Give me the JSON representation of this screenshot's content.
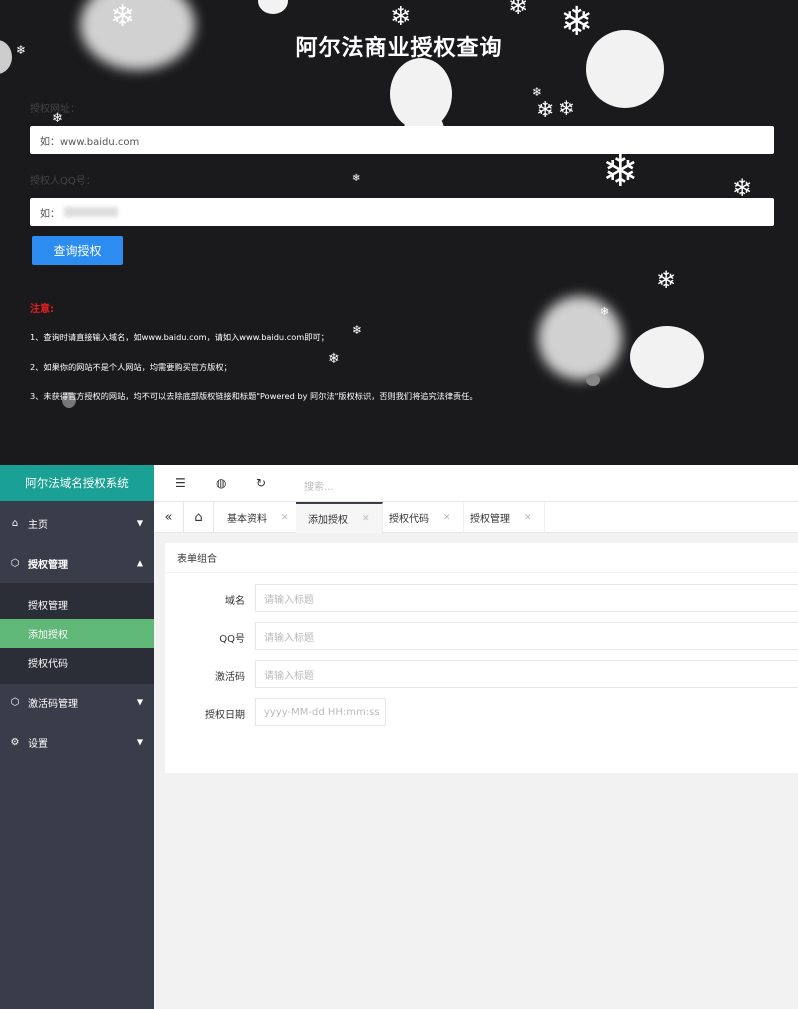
{
  "query": {
    "title": "阿尔法商业授权查询",
    "url_label": "授权网址：",
    "url_placeholder": "如：www.baidu.com",
    "qq_label": "授权人QQ号：",
    "qq_placeholder": "如：",
    "button": "查询授权",
    "notice_title": "注意:",
    "notices": [
      "1、查询时请直接输入域名，如www.baidu.com，请如入www.baidu.com即可；",
      "2、如果你的网站不是个人网站，均需要购买官方版权；",
      "3、未获得官方授权的网站，均不可以去除底部版权链接和标题\"Powered by 阿尔法\"版权标识，否则我们将追究法律责任。"
    ]
  },
  "admin": {
    "logo": "阿尔法域名授权系统",
    "nav": [
      {
        "label": "主页",
        "icon": "home-icon"
      },
      {
        "label": "授权管理",
        "icon": "cube-icon"
      },
      {
        "label": "激活码管理",
        "icon": "cube-icon"
      },
      {
        "label": "设置",
        "icon": "gear-icon"
      }
    ],
    "sub_items": [
      "授权管理",
      "添加授权",
      "授权代码"
    ],
    "search_placeholder": "搜索...",
    "tabs": [
      "基本资料",
      "添加授权",
      "授权代码",
      "授权管理"
    ],
    "card_title": "表单组合",
    "form": [
      {
        "label": "域名",
        "placeholder": "请输入标题"
      },
      {
        "label": "QQ号",
        "placeholder": "请输入标题"
      },
      {
        "label": "激活码",
        "placeholder": "请输入标题"
      },
      {
        "label": "授权日期",
        "placeholder": "yyyy-MM-dd HH:mm:ss"
      }
    ],
    "colors": {
      "logo_bg": "#1aa094",
      "active_bg": "#5fb878",
      "sidebar_bg": "#393d49",
      "button_bg": "#2d8cf0",
      "notice_red": "#e02020"
    }
  }
}
